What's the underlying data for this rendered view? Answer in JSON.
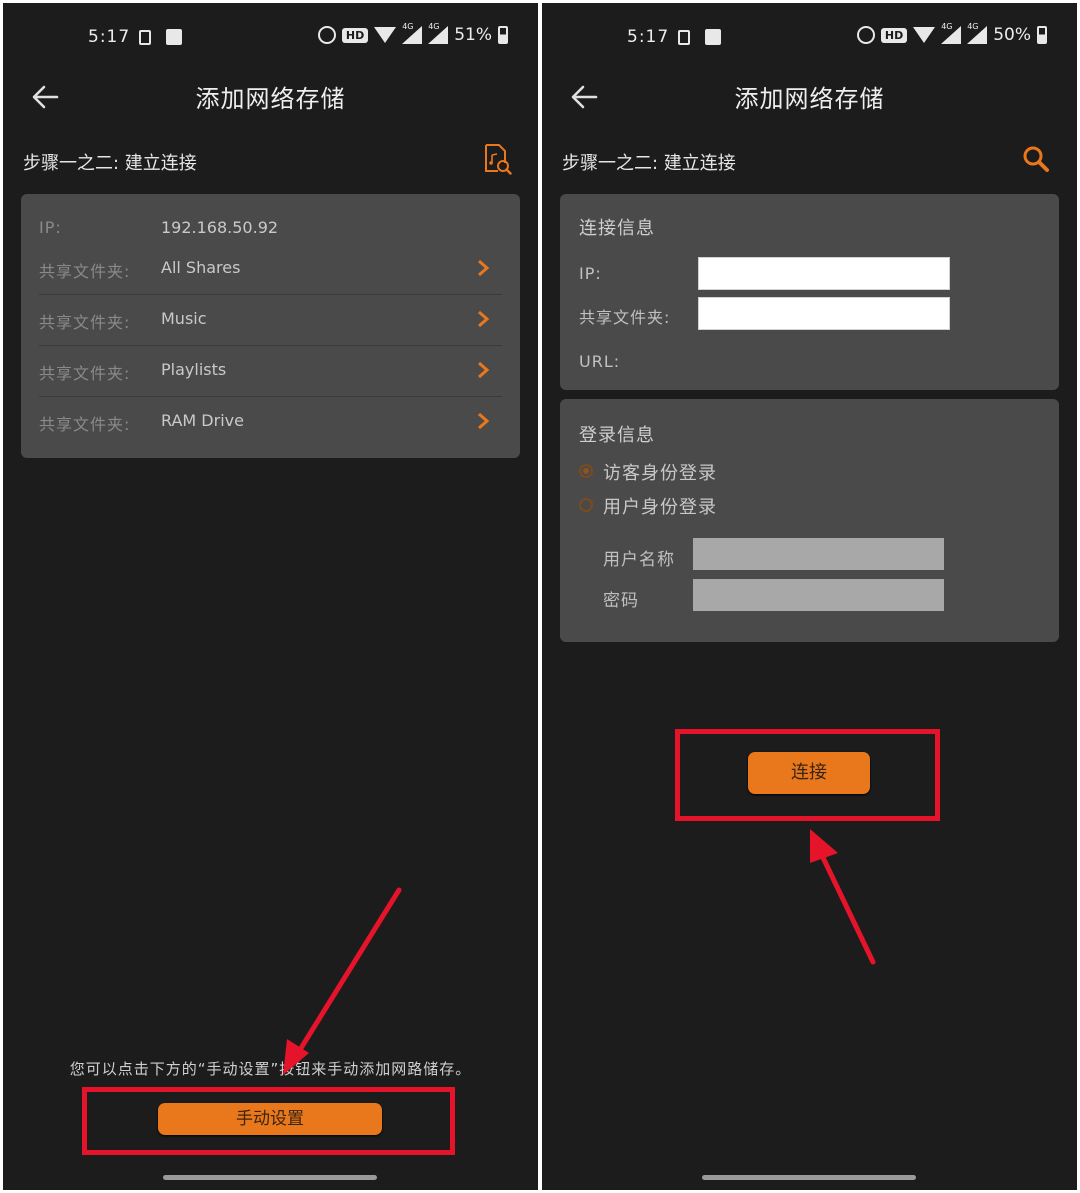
{
  "status_left": {
    "time": "5:17",
    "battery": "51%"
  },
  "status_right": {
    "time": "5:17",
    "battery": "50%"
  },
  "status_common": {
    "hd_label": "HD",
    "signal_label": "4G"
  },
  "left": {
    "title": "添加网络存储",
    "step": "步骤一之二: 建立连接",
    "ip_label": "IP:",
    "ip_value": "192.168.50.92",
    "shares": [
      {
        "label": "共享文件夹:",
        "value": "All Shares"
      },
      {
        "label": "共享文件夹:",
        "value": "Music"
      },
      {
        "label": "共享文件夹:",
        "value": "Playlists"
      },
      {
        "label": "共享文件夹:",
        "value": "RAM Drive"
      }
    ],
    "hint": "您可以点击下方的“手动设置”按钮来手动添加网路储存。",
    "manual_button": "手动设置"
  },
  "right": {
    "title": "添加网络存储",
    "step": "步骤一之二: 建立连接",
    "connection_section": "连接信息",
    "ip_label": "IP:",
    "ip_value": "",
    "share_label": "共享文件夹:",
    "share_value": "",
    "url_label": "URL:",
    "login_section": "登录信息",
    "guest_option": "访客身份登录",
    "user_option": "用户身份登录",
    "guest_selected": true,
    "username_label": "用户名称",
    "password_label": "密码",
    "connect_button": "连接"
  },
  "colors": {
    "accent": "#e9771c",
    "background": "#1c1c1c",
    "card": "#4a4a4a",
    "highlight": "#e5142a"
  }
}
